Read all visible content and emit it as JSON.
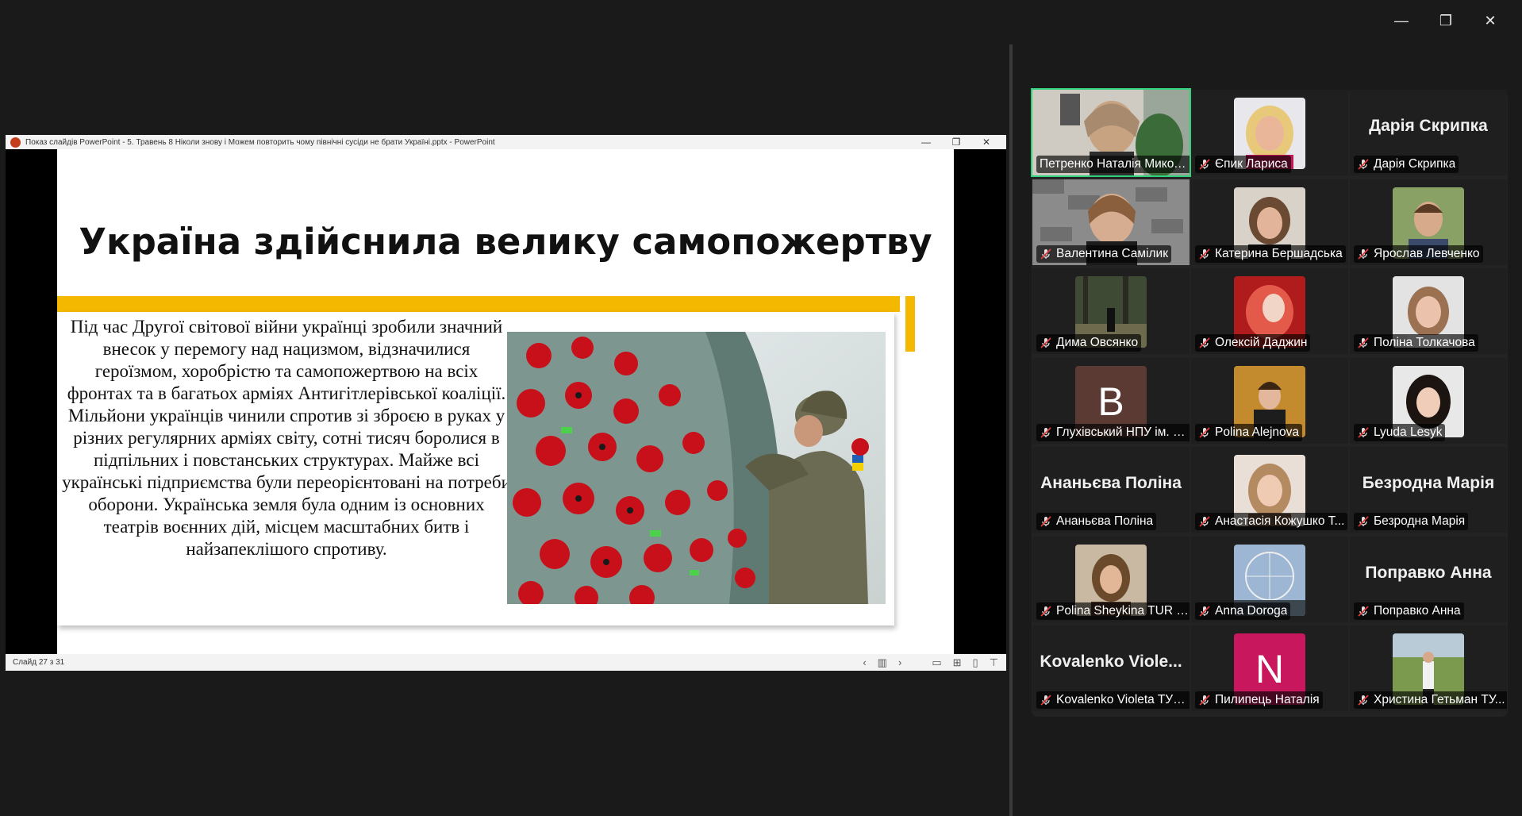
{
  "window": {
    "minimize": "—",
    "restore": "❐",
    "close": "✕"
  },
  "ppt": {
    "title": "Показ слайдів PowerPoint  -  5. Травень 8 Ніколи знову і Можем повторить чому північні сусіди не брати Україні.pptx - PowerPoint",
    "slide_counter": "Слайд 27 з 31",
    "slide": {
      "heading": "Україна здійснила велику самопожертву",
      "body": "Під час Другої світової війни українці зробили значний внесок у перемогу над нацизмом, відзначилися героїзмом, хоробрістю та самопожертвою на всіх фронтах та в багатьох арміях Антигітлерівської коаліції. Мільйони українців чинили спротив зі зброєю в руках у різних регулярних арміях світу, сотні тисяч боролися в підпільних і повстанських структурах. Майже всі українські підприємства були переорієнтовані на потреби оборони. Українська земля була одним із основних театрів воєнних дій, місцем масштабних битв і найзапеклішого спротиву."
    },
    "colors": {
      "accent": "#f5b800"
    }
  },
  "participants": [
    {
      "name": "Петренко Наталія Микол...",
      "kind": "video-woman",
      "active": true,
      "muted": false
    },
    {
      "name": "Єпик Лариса",
      "kind": "photo-blonde",
      "muted": true
    },
    {
      "name": "Дарія Скрипка",
      "kind": "name",
      "muted": true
    },
    {
      "name": "Валентина Самілик",
      "kind": "video-wall",
      "muted": true
    },
    {
      "name": "Катерина Бершадська",
      "kind": "photo-woman",
      "muted": true
    },
    {
      "name": "Ярослав Левченко",
      "kind": "photo-boy",
      "muted": true
    },
    {
      "name": "Дима Овсянко",
      "kind": "photo-park",
      "muted": true
    },
    {
      "name": "Олексій Даджин",
      "kind": "photo-red",
      "muted": true
    },
    {
      "name": "Поліна Толкачова",
      "kind": "photo-girl",
      "muted": true
    },
    {
      "name": "Глухівський НПУ ім. Д...",
      "kind": "letter",
      "letter": "B",
      "color": "#5a3a32",
      "muted": true
    },
    {
      "name": "Polina Alejnova",
      "kind": "photo-autumn",
      "muted": true
    },
    {
      "name": "Lyuda Lesyk",
      "kind": "photo-dark",
      "muted": true
    },
    {
      "name": "Ананьєва Поліна",
      "kind": "name",
      "muted": true
    },
    {
      "name": "Анастасія Кожушко Т...",
      "kind": "photo-girl2",
      "muted": true
    },
    {
      "name": "Безродна Марія",
      "kind": "name",
      "muted": true
    },
    {
      "name": "Polina Sheykina TUR 2...",
      "kind": "photo-brown",
      "muted": true
    },
    {
      "name": "Anna Doroga",
      "kind": "photo-wheel",
      "muted": true
    },
    {
      "name": "Поправко Анна",
      "kind": "name",
      "muted": true
    },
    {
      "name": "Kovalenko Violeta TУР...",
      "kind": "name",
      "display": "Kovalenko  Viole...",
      "muted": true
    },
    {
      "name": "Пилипець Наталія",
      "kind": "letter",
      "letter": "N",
      "color": "#c8175d",
      "muted": true
    },
    {
      "name": "Христина Гетьман ТУ...",
      "kind": "photo-outdoor",
      "muted": true
    }
  ]
}
